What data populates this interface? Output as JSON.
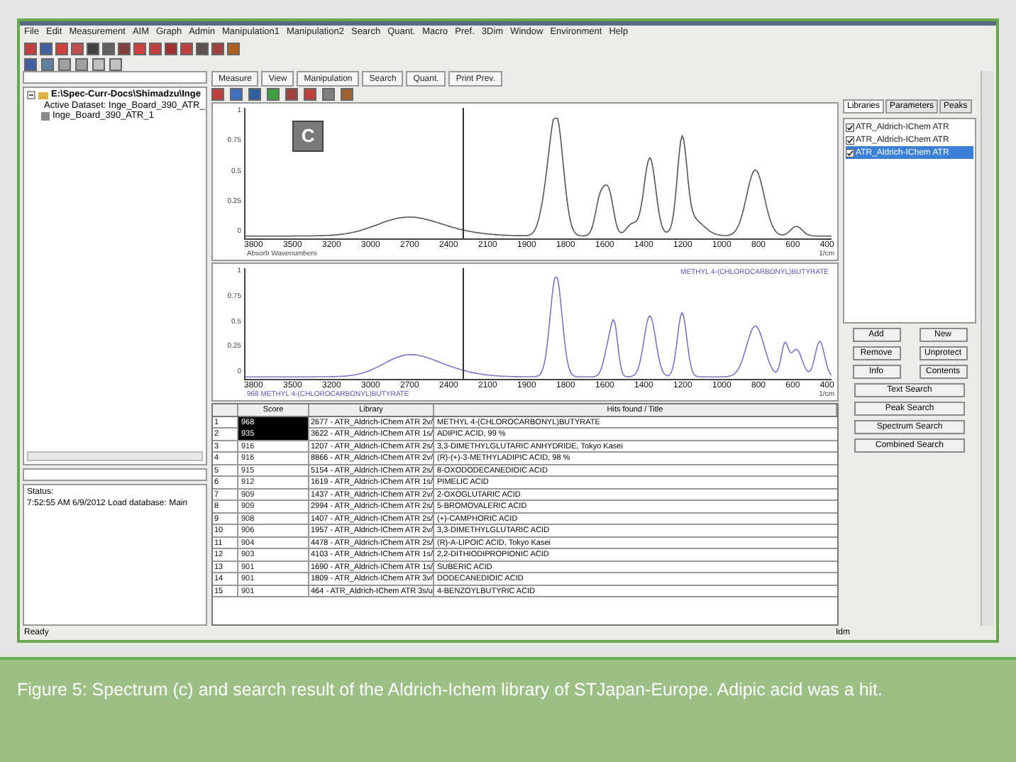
{
  "menu": [
    "File",
    "Edit",
    "Measurement",
    "AIM",
    "Graph",
    "Admin",
    "Manipulation1",
    "Manipulation2",
    "Search",
    "Quant.",
    "Macro",
    "Pref.",
    "3Dim",
    "Window",
    "Environment",
    "Help"
  ],
  "tree": {
    "label": "E:\\Spec-Curr-Docs\\Shimadzu\\Inge",
    "expanded": true,
    "children": [
      {
        "label": "Active Dataset: Inge_Board_390_ATR_"
      },
      {
        "label": "Inge_Board_390_ATR_1"
      }
    ]
  },
  "status_panel": {
    "label": "Status:",
    "message": "7:52:55 AM 6/9/2012 Load database: Main"
  },
  "toolbar_tabs": [
    {
      "label": "Measure",
      "disabled": false
    },
    {
      "label": "View",
      "disabled": false
    },
    {
      "label": "Manipulation",
      "disabled": false
    },
    {
      "label": "Search",
      "disabled": false
    },
    {
      "label": "Quant.",
      "disabled": false
    },
    {
      "label": "Print Prev.",
      "disabled": false
    }
  ],
  "charts": [
    {
      "badge": "C",
      "y_ticks": [
        "1",
        "0.75",
        "0.5",
        "0.25",
        "0"
      ],
      "x_ticks": [
        "3800",
        "3500",
        "3200",
        "3000",
        "2700",
        "2400",
        "2100",
        "1900",
        "1800",
        "1600",
        "1400",
        "1200",
        "1000",
        "800",
        "600",
        "400"
      ],
      "x_caption": "Absorb Wavenumbers",
      "unit": "1/cm",
      "color": "#555555"
    },
    {
      "legend": "METHYL 4-(CHLOROCARBONYL)BUTYRATE",
      "y_ticks": [
        "1",
        "0.75",
        "0.5",
        "0.25",
        "0"
      ],
      "x_ticks": [
        "3800",
        "3500",
        "3200",
        "3000",
        "2700",
        "2400",
        "2100",
        "1900",
        "1800",
        "1600",
        "1400",
        "1200",
        "1000",
        "800",
        "600",
        "400"
      ],
      "x_caption": "968 METHYL 4-(CHLOROCARBONYL)BUTYRATE",
      "unit": "1/cm",
      "color": "#7b74c8"
    }
  ],
  "table": {
    "columns": [
      "",
      "Score",
      "Library",
      "Hits found / Title"
    ],
    "rows": [
      {
        "n": "1",
        "score": "968",
        "library": "2677 - ATR_Aldrich-IChem ATR 2v/",
        "title": "METHYL 4-(CHLOROCARBONYL)BUTYRATE",
        "selected": true
      },
      {
        "n": "2",
        "score": "935",
        "library": "3622 - ATR_Aldrich-IChem ATR 1s/",
        "title": "ADIPIC ACID, 99 %",
        "selected": true
      },
      {
        "n": "3",
        "score": "916",
        "library": "1207 - ATR_Aldrich-IChem ATR 2s/",
        "title": "3,3-DIMETHYLGLUTARIC ANHYDRIDE, Tokyo Kasei",
        "selected": false
      },
      {
        "n": "4",
        "score": "916",
        "library": "8866 - ATR_Aldrich-IChem ATR 2v/",
        "title": "(R)-(+)-3-METHYLADIPIC ACID, 98 %",
        "selected": false
      },
      {
        "n": "5",
        "score": "915",
        "library": "5154 - ATR_Aldrich-IChem ATR 2s/",
        "title": "8-OXODODECANEDIOIC ACID",
        "selected": false
      },
      {
        "n": "6",
        "score": "912",
        "library": "1619 - ATR_Aldrich-IChem ATR 1s/",
        "title": "PIMELIC ACID",
        "selected": false
      },
      {
        "n": "7",
        "score": "909",
        "library": "1437 - ATR_Aldrich-IChem ATR 2v/",
        "title": "2-OXOGLUTARIC ACID",
        "selected": false
      },
      {
        "n": "8",
        "score": "909",
        "library": "2994 - ATR_Aldrich-IChem ATR 2s/",
        "title": "5-BROMOVALERIC ACID",
        "selected": false
      },
      {
        "n": "9",
        "score": "908",
        "library": "1407 - ATR_Aldrich-IChem ATR 2s/",
        "title": "(+)-CAMPHORIC ACID",
        "selected": false
      },
      {
        "n": "10",
        "score": "906",
        "library": "1957 - ATR_Aldrich-IChem ATR 2v/",
        "title": "3,3-DIMETHYLGLUTARIC ACID",
        "selected": false
      },
      {
        "n": "11",
        "score": "904",
        "library": "4478 - ATR_Aldrich-IChem ATR 2s/",
        "title": "(R)-A-LIPOIC ACID, Tokyo Kasei",
        "selected": false
      },
      {
        "n": "12",
        "score": "903",
        "library": "4103 - ATR_Aldrich-IChem ATR 1s/",
        "title": "2,2-DITHIODIPROPIONIC ACID",
        "selected": false
      },
      {
        "n": "13",
        "score": "901",
        "library": "1690 - ATR_Aldrich-IChem ATR 1s/",
        "title": "SUBERIC ACID",
        "selected": false
      },
      {
        "n": "14",
        "score": "901",
        "library": "1809 - ATR_Aldrich-IChem ATR 3v/",
        "title": "DODECANEDIOIC ACID",
        "selected": false
      },
      {
        "n": "15",
        "score": "901",
        "library": "464 - ATR_Aldrich-IChem ATR 3s/u",
        "title": "4-BENZOYLBUTYRIC ACID",
        "selected": false
      }
    ]
  },
  "side_tabs": [
    {
      "label": "Libraries",
      "selected": true
    },
    {
      "label": "Parameters",
      "selected": false
    },
    {
      "label": "Peaks",
      "selected": false
    }
  ],
  "libraries": [
    {
      "label": "ATR_Aldrich-IChem ATR",
      "checked": true,
      "selected": false
    },
    {
      "label": "ATR_Aldrich-IChem ATR",
      "checked": true,
      "selected": false
    },
    {
      "label": "ATR_Aldrich-IChem ATR",
      "checked": true,
      "selected": true
    }
  ],
  "button_pairs": [
    [
      "Add",
      "New"
    ],
    [
      "Remove",
      "Unprotect"
    ],
    [
      "Info",
      "Contents"
    ]
  ],
  "search_buttons": [
    "Text Search",
    "Peak Search",
    "Spectrum Search",
    "Combined Search"
  ],
  "status_bar": {
    "left": "Ready",
    "right": "Idm"
  },
  "caption": "Figure 5: Spectrum (c) and search result of the Aldrich-Ichem library of STJapan-Europe. Adipic acid was a hit."
}
